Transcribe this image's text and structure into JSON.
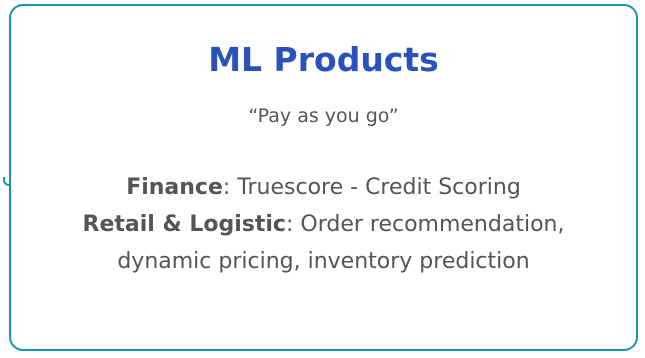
{
  "card": {
    "title": "ML Products",
    "subtitle": "“Pay as you go”",
    "lines": [
      {
        "label": "Finance",
        "text": ": Truescore - Credit Scoring"
      },
      {
        "label": "Retail & Logistic",
        "text": ": Order recommendation,"
      },
      {
        "text": "dynamic pricing, inventory prediction"
      }
    ]
  },
  "colors": {
    "border": "#1a93b3",
    "title": "#2a52b9",
    "text": "#555555"
  }
}
